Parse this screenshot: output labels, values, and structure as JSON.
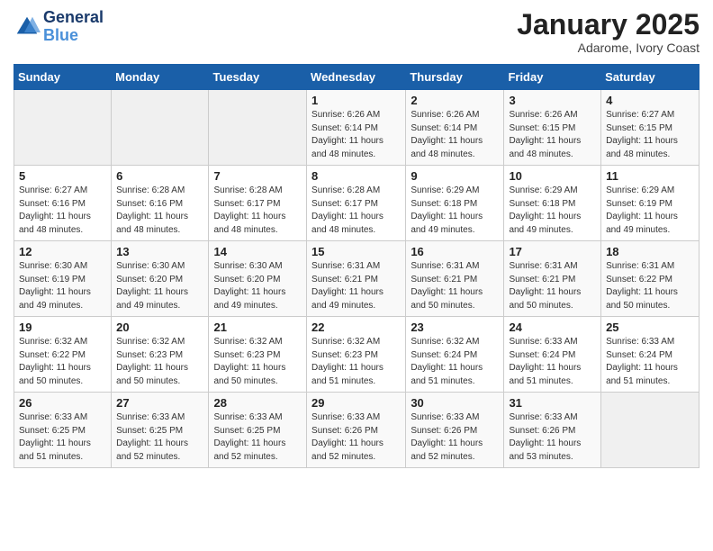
{
  "header": {
    "logo_line1": "General",
    "logo_line2": "Blue",
    "month": "January 2025",
    "location": "Adarome, Ivory Coast"
  },
  "weekdays": [
    "Sunday",
    "Monday",
    "Tuesday",
    "Wednesday",
    "Thursday",
    "Friday",
    "Saturday"
  ],
  "weeks": [
    [
      {
        "day": "",
        "info": ""
      },
      {
        "day": "",
        "info": ""
      },
      {
        "day": "",
        "info": ""
      },
      {
        "day": "1",
        "info": "Sunrise: 6:26 AM\nSunset: 6:14 PM\nDaylight: 11 hours\nand 48 minutes."
      },
      {
        "day": "2",
        "info": "Sunrise: 6:26 AM\nSunset: 6:14 PM\nDaylight: 11 hours\nand 48 minutes."
      },
      {
        "day": "3",
        "info": "Sunrise: 6:26 AM\nSunset: 6:15 PM\nDaylight: 11 hours\nand 48 minutes."
      },
      {
        "day": "4",
        "info": "Sunrise: 6:27 AM\nSunset: 6:15 PM\nDaylight: 11 hours\nand 48 minutes."
      }
    ],
    [
      {
        "day": "5",
        "info": "Sunrise: 6:27 AM\nSunset: 6:16 PM\nDaylight: 11 hours\nand 48 minutes."
      },
      {
        "day": "6",
        "info": "Sunrise: 6:28 AM\nSunset: 6:16 PM\nDaylight: 11 hours\nand 48 minutes."
      },
      {
        "day": "7",
        "info": "Sunrise: 6:28 AM\nSunset: 6:17 PM\nDaylight: 11 hours\nand 48 minutes."
      },
      {
        "day": "8",
        "info": "Sunrise: 6:28 AM\nSunset: 6:17 PM\nDaylight: 11 hours\nand 48 minutes."
      },
      {
        "day": "9",
        "info": "Sunrise: 6:29 AM\nSunset: 6:18 PM\nDaylight: 11 hours\nand 49 minutes."
      },
      {
        "day": "10",
        "info": "Sunrise: 6:29 AM\nSunset: 6:18 PM\nDaylight: 11 hours\nand 49 minutes."
      },
      {
        "day": "11",
        "info": "Sunrise: 6:29 AM\nSunset: 6:19 PM\nDaylight: 11 hours\nand 49 minutes."
      }
    ],
    [
      {
        "day": "12",
        "info": "Sunrise: 6:30 AM\nSunset: 6:19 PM\nDaylight: 11 hours\nand 49 minutes."
      },
      {
        "day": "13",
        "info": "Sunrise: 6:30 AM\nSunset: 6:20 PM\nDaylight: 11 hours\nand 49 minutes."
      },
      {
        "day": "14",
        "info": "Sunrise: 6:30 AM\nSunset: 6:20 PM\nDaylight: 11 hours\nand 49 minutes."
      },
      {
        "day": "15",
        "info": "Sunrise: 6:31 AM\nSunset: 6:21 PM\nDaylight: 11 hours\nand 49 minutes."
      },
      {
        "day": "16",
        "info": "Sunrise: 6:31 AM\nSunset: 6:21 PM\nDaylight: 11 hours\nand 50 minutes."
      },
      {
        "day": "17",
        "info": "Sunrise: 6:31 AM\nSunset: 6:21 PM\nDaylight: 11 hours\nand 50 minutes."
      },
      {
        "day": "18",
        "info": "Sunrise: 6:31 AM\nSunset: 6:22 PM\nDaylight: 11 hours\nand 50 minutes."
      }
    ],
    [
      {
        "day": "19",
        "info": "Sunrise: 6:32 AM\nSunset: 6:22 PM\nDaylight: 11 hours\nand 50 minutes."
      },
      {
        "day": "20",
        "info": "Sunrise: 6:32 AM\nSunset: 6:23 PM\nDaylight: 11 hours\nand 50 minutes."
      },
      {
        "day": "21",
        "info": "Sunrise: 6:32 AM\nSunset: 6:23 PM\nDaylight: 11 hours\nand 50 minutes."
      },
      {
        "day": "22",
        "info": "Sunrise: 6:32 AM\nSunset: 6:23 PM\nDaylight: 11 hours\nand 51 minutes."
      },
      {
        "day": "23",
        "info": "Sunrise: 6:32 AM\nSunset: 6:24 PM\nDaylight: 11 hours\nand 51 minutes."
      },
      {
        "day": "24",
        "info": "Sunrise: 6:33 AM\nSunset: 6:24 PM\nDaylight: 11 hours\nand 51 minutes."
      },
      {
        "day": "25",
        "info": "Sunrise: 6:33 AM\nSunset: 6:24 PM\nDaylight: 11 hours\nand 51 minutes."
      }
    ],
    [
      {
        "day": "26",
        "info": "Sunrise: 6:33 AM\nSunset: 6:25 PM\nDaylight: 11 hours\nand 51 minutes."
      },
      {
        "day": "27",
        "info": "Sunrise: 6:33 AM\nSunset: 6:25 PM\nDaylight: 11 hours\nand 52 minutes."
      },
      {
        "day": "28",
        "info": "Sunrise: 6:33 AM\nSunset: 6:25 PM\nDaylight: 11 hours\nand 52 minutes."
      },
      {
        "day": "29",
        "info": "Sunrise: 6:33 AM\nSunset: 6:26 PM\nDaylight: 11 hours\nand 52 minutes."
      },
      {
        "day": "30",
        "info": "Sunrise: 6:33 AM\nSunset: 6:26 PM\nDaylight: 11 hours\nand 52 minutes."
      },
      {
        "day": "31",
        "info": "Sunrise: 6:33 AM\nSunset: 6:26 PM\nDaylight: 11 hours\nand 53 minutes."
      },
      {
        "day": "",
        "info": ""
      }
    ]
  ]
}
